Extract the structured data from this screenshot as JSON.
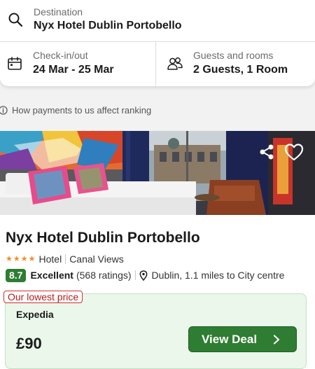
{
  "search": {
    "destination_label": "Destination",
    "destination_value": "Nyx Hotel Dublin Portobello",
    "dates_label": "Check-in/out",
    "dates_value": "24 Mar - 25 Mar",
    "guests_label": "Guests and rooms",
    "guests_value": "2 Guests, 1 Room"
  },
  "ranking_info": {
    "text": "How payments to us affect ranking"
  },
  "hotel": {
    "name": "Nyx Hotel Dublin Portobello",
    "stars": 4,
    "type": "Hotel",
    "feature": "Canal Views",
    "score": "8.7",
    "score_text": "Excellent",
    "ratings_count": "(568 ratings)",
    "location": "Dublin, 1.1 miles to City centre"
  },
  "deal": {
    "tag": "Our lowest price",
    "provider": "Expedia",
    "price": "£90",
    "button_label": "View Deal"
  },
  "icons": {
    "search": "search-icon",
    "calendar": "calendar-icon",
    "guests": "guests-icon",
    "info": "info-icon",
    "share": "share-icon",
    "favorite": "heart-icon",
    "pin": "location-pin-icon",
    "chevron": "chevron-right-icon"
  },
  "colors": {
    "accent_green": "#2e7d32",
    "deal_bg": "#eaf7ea",
    "tag_red": "#d32f2f",
    "star_orange": "#f08c28"
  }
}
